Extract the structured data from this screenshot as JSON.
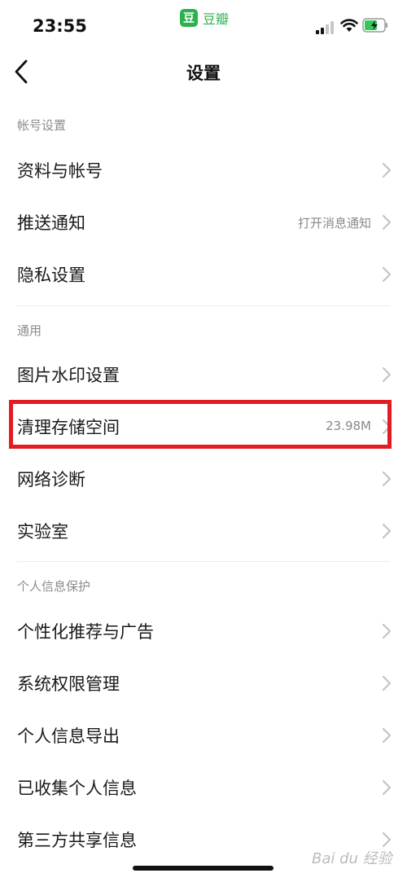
{
  "status_bar": {
    "time": "23:55",
    "app_name": "豆瓣",
    "app_logo_char": "豆"
  },
  "nav": {
    "title": "设置"
  },
  "sections": [
    {
      "label": "帐号设置",
      "items": [
        {
          "label": "资料与帐号",
          "value": ""
        },
        {
          "label": "推送通知",
          "value": "打开消息通知"
        },
        {
          "label": "隐私设置",
          "value": ""
        }
      ]
    },
    {
      "label": "通用",
      "items": [
        {
          "label": "图片水印设置",
          "value": ""
        },
        {
          "label": "清理存储空间",
          "value": "23.98M"
        },
        {
          "label": "网络诊断",
          "value": ""
        },
        {
          "label": "实验室",
          "value": ""
        }
      ]
    },
    {
      "label": "个人信息保护",
      "items": [
        {
          "label": "个性化推荐与广告",
          "value": ""
        },
        {
          "label": "系统权限管理",
          "value": ""
        },
        {
          "label": "个人信息导出",
          "value": ""
        },
        {
          "label": "已收集个人信息",
          "value": ""
        },
        {
          "label": "第三方共享信息",
          "value": ""
        }
      ]
    }
  ],
  "colors": {
    "accent": "#2bb24c",
    "highlight": "#e31c23"
  },
  "watermark": "Bai du 经验"
}
